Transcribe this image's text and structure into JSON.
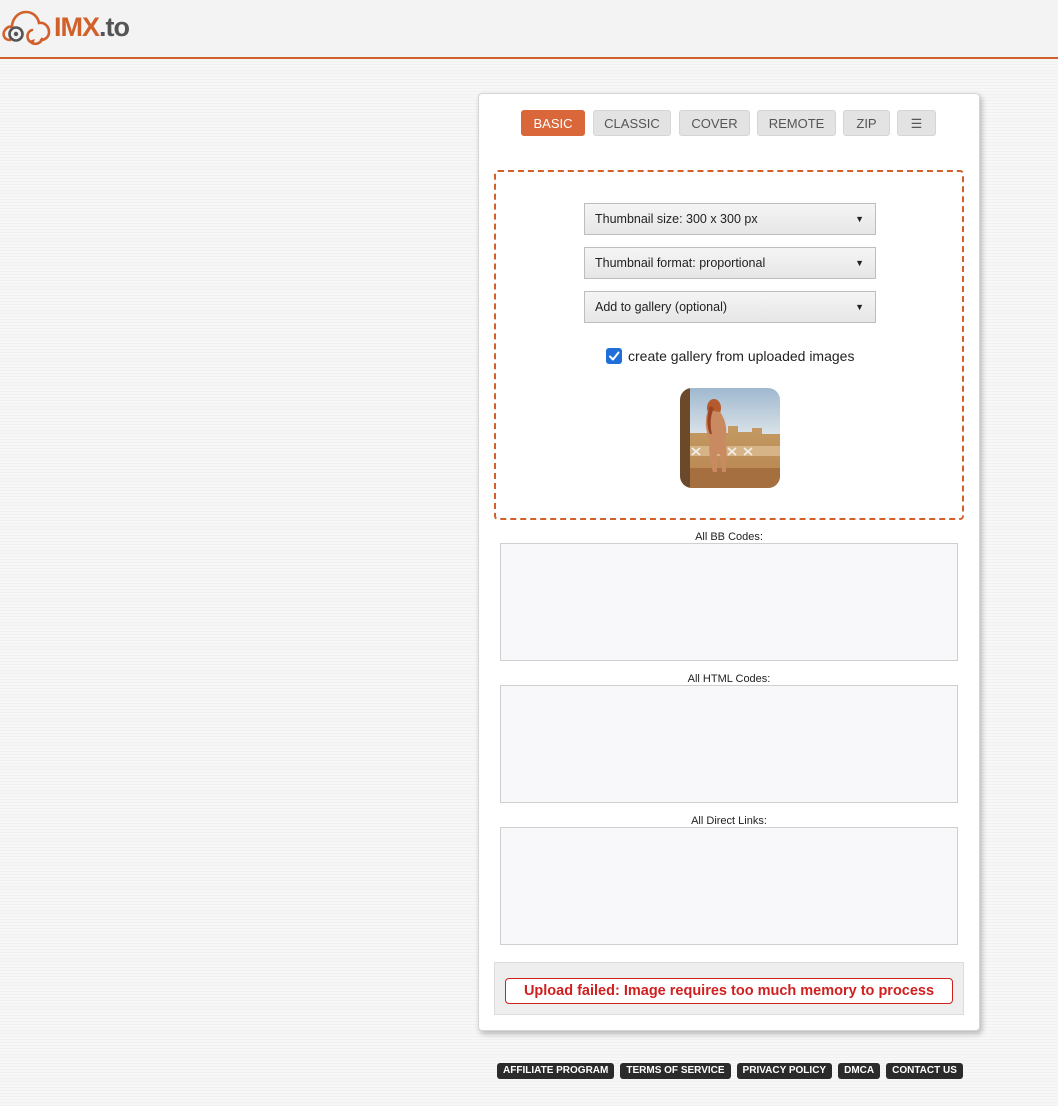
{
  "header": {
    "logo_brand": "IMX",
    "logo_tld": ".to"
  },
  "tabs": [
    {
      "label": "BASIC",
      "active": true
    },
    {
      "label": "CLASSIC",
      "active": false
    },
    {
      "label": "COVER",
      "active": false
    },
    {
      "label": "REMOTE",
      "active": false
    },
    {
      "label": "ZIP",
      "active": false
    },
    {
      "label": "☰",
      "active": false
    }
  ],
  "upload": {
    "thumbnail_size": "Thumbnail size: 300 x 300 px",
    "thumbnail_format": "Thumbnail format: proportional",
    "gallery_select": "Add to gallery (optional)",
    "create_gallery_label": "create gallery from uploaded images",
    "create_gallery_checked": true
  },
  "codes": {
    "bb_label": "All BB Codes:",
    "html_label": "All HTML Codes:",
    "direct_label": "All Direct Links:"
  },
  "error": {
    "message": "Upload failed: Image requires too much memory to process"
  },
  "footer": {
    "links": [
      "AFFILIATE PROGRAM",
      "TERMS OF SERVICE",
      "PRIVACY POLICY",
      "DMCA",
      "CONTACT US"
    ]
  },
  "colors": {
    "accent": "#d2602a",
    "error": "#d01f1f",
    "checkbox": "#1e6fd9"
  }
}
